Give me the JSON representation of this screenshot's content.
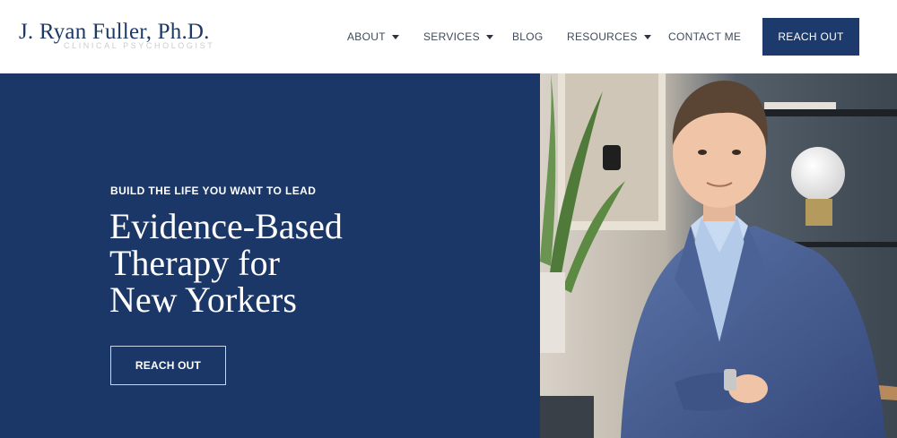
{
  "header": {
    "logo_name": "J. Ryan Fuller, Ph.D.",
    "logo_subtitle": "CLINICAL PSYCHOLOGIST",
    "nav": {
      "about": "ABOUT",
      "services": "SERVICES",
      "blog": "BLOG",
      "resources": "RESOURCES",
      "contact": "CONTACT ME"
    },
    "cta_label": "REACH OUT"
  },
  "hero": {
    "eyebrow": "BUILD THE LIFE YOU WANT TO LEAD",
    "headline_line1": "Evidence-Based",
    "headline_line2": "Therapy for",
    "headline_line3": "New Yorkers",
    "cta_label": "REACH OUT"
  },
  "colors": {
    "brand_navy": "#1b3768",
    "header_bg": "#ffffff",
    "nav_text": "#3f4a5a"
  },
  "icons": {
    "dropdown": "chevron-down-icon"
  }
}
